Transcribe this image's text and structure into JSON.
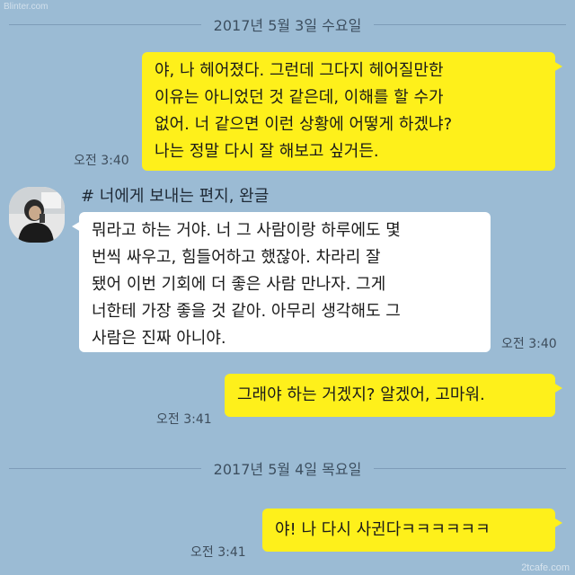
{
  "watermark_top": "Blinter.com",
  "watermark_bottom": "2tcafe.com",
  "dates": {
    "first": "2017년 5월 3일 수요일",
    "second": "2017년 5월 4일 목요일"
  },
  "sender": {
    "name": "# 너에게 보내는 편지, 완글"
  },
  "messages": {
    "m1": {
      "lines": [
        "야, 나 헤어졌다. 그런데 그다지 헤어질만한",
        "이유는 아니었던 것 같은데, 이해를 할 수가",
        "없어. 너 같으면 이런 상황에 어떻게 하겠냐?",
        "나는 정말 다시 잘 해보고 싶거든."
      ],
      "time": "오전 3:40"
    },
    "m2": {
      "lines": [
        "뭐라고 하는 거야. 너 그 사람이랑 하루에도 몇",
        "번씩 싸우고, 힘들어하고 했잖아. 차라리 잘",
        "됐어 이번 기회에 더 좋은 사람 만나자. 그게",
        "너한테 가장 좋을 것 같아. 아무리 생각해도 그",
        "사람은 진짜 아니야."
      ],
      "time": "오전 3:40"
    },
    "m3": {
      "lines": [
        "그래야 하는 거겠지? 알겠어, 고마워."
      ],
      "time": "오전 3:41"
    },
    "m4": {
      "lines": [
        "야! 나 다시 사귄다ㅋㅋㅋㅋㅋㅋ"
      ],
      "time": "오전 3:41"
    }
  },
  "colors": {
    "background": "#9bbbd4",
    "my_bubble": "#fef01b",
    "their_bubble": "#ffffff"
  }
}
